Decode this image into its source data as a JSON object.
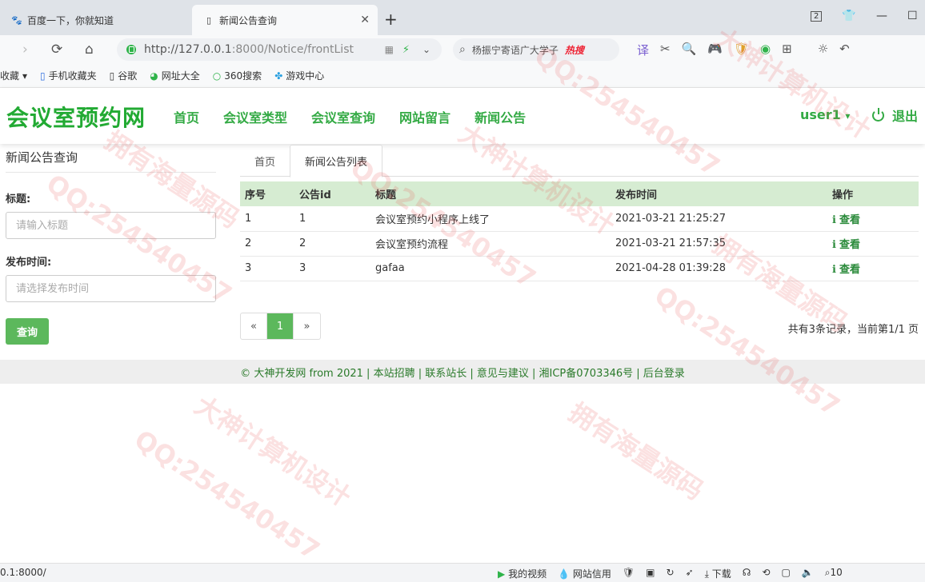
{
  "browser": {
    "tabs": [
      {
        "title": "百度一下，你就知道",
        "icon": "baidu-paw-icon"
      },
      {
        "title": "新闻公告查询",
        "icon": "page-icon"
      }
    ],
    "new_tab": "+",
    "tab_count": "2",
    "url_host": "http://127.0.0.1",
    "url_path": ":8000/Notice/frontList",
    "search_text": "杨振宁寄语广大学子",
    "search_hot": "热搜",
    "bookmarks": [
      {
        "label": "收藏",
        "icon": "star-icon"
      },
      {
        "label": "手机收藏夹",
        "icon": "phone-icon"
      },
      {
        "label": "谷歌",
        "icon": "page-icon"
      },
      {
        "label": "网址大全",
        "icon": "globe-icon"
      },
      {
        "label": "360搜索",
        "icon": "search-icon"
      },
      {
        "label": "游戏中心",
        "icon": "game-icon"
      }
    ],
    "status_url": "0.1:8000/",
    "status_items": [
      "我的视频",
      "网站信用",
      "下载",
      "10"
    ]
  },
  "site": {
    "logo": "会议室预约网",
    "nav": [
      "首页",
      "会议室类型",
      "会议室查询",
      "网站留言",
      "新闻公告"
    ],
    "user": "user1",
    "user_caret": "▾",
    "logout": "退出"
  },
  "sidebar": {
    "title": "新闻公告查询",
    "title_label": "标题:",
    "title_placeholder": "请输入标题",
    "time_label": "发布时间:",
    "time_placeholder": "请选择发布时间",
    "query_button": "查询"
  },
  "content": {
    "tabs": [
      "首页",
      "新闻公告列表"
    ],
    "columns": [
      "序号",
      "公告id",
      "标题",
      "发布时间",
      "操作"
    ],
    "rows": [
      {
        "no": "1",
        "id": "1",
        "title": "会议室预约小程序上线了",
        "time": "2021-03-21 21:25:27",
        "action": "查看"
      },
      {
        "no": "2",
        "id": "2",
        "title": "会议室预约流程",
        "time": "2021-03-21 21:57:35",
        "action": "查看"
      },
      {
        "no": "3",
        "id": "3",
        "title": "gafaa",
        "time": "2021-04-28 01:39:28",
        "action": "查看"
      }
    ],
    "pager": {
      "prev": "«",
      "current": "1",
      "next": "»"
    },
    "pager_info": "共有3条记录，当前第1/1 页"
  },
  "footer": "© 大神开发网 from 2021 | 本站招聘 | 联系站长 | 意见与建议 | 湘ICP备0703346号 | 后台登录",
  "watermarks": [
    "QQ:254540457",
    "大神计算机设计",
    "拥有海量源码"
  ],
  "colors": {
    "brand": "#22aa33",
    "table_header": "#d6ecd2",
    "button": "#5cb85c"
  }
}
